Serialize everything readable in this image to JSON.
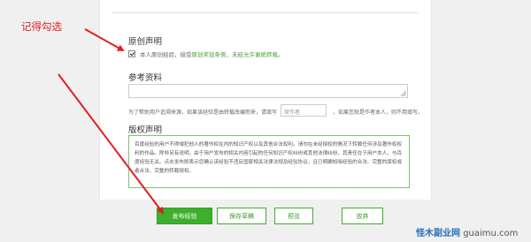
{
  "annotation": {
    "label": "记得勾选"
  },
  "original": {
    "title": "原创声明",
    "checked": true,
    "text_before": "本人原创经验，接受",
    "terms_link": "原创奖惩条例",
    "text_after": "，未经允许谢绝转载。"
  },
  "reference": {
    "title": "参考资料",
    "text_before": "为了帮助用户追溯来源，如果该经验是由转载改编而来，请填写",
    "author_placeholder": "原作者",
    "text_after": "，如果您就是作者本人，则不用填写。"
  },
  "copyright": {
    "title": "版权声明",
    "body": "百度经验的用户不得侵犯他人的著作权在内的知识产权以及其他合法权利。请勿在未经授权的情况下转载任何涉及著作权权利的作品。除非另有说明，由于用户发布的相关内容引起的任何知识产权纠纷或其他法律纠纷，其责任在于用户本人，与百度经验无关。点击发布即表示您确认该经验不违反国家相关法律法规及经验协议，且已明确知晓经验的合法、完整的版权或者合法、完整的转载授权。"
  },
  "buttons": {
    "publish": "发布经验",
    "save_draft": "保存草稿",
    "preview": "预览",
    "cancel": "放弃"
  },
  "watermark": {
    "cn": "怪木副业网",
    "en": "guaimu.com"
  },
  "colors": {
    "accent": "#3daf2c",
    "annotation": "#e02020"
  }
}
